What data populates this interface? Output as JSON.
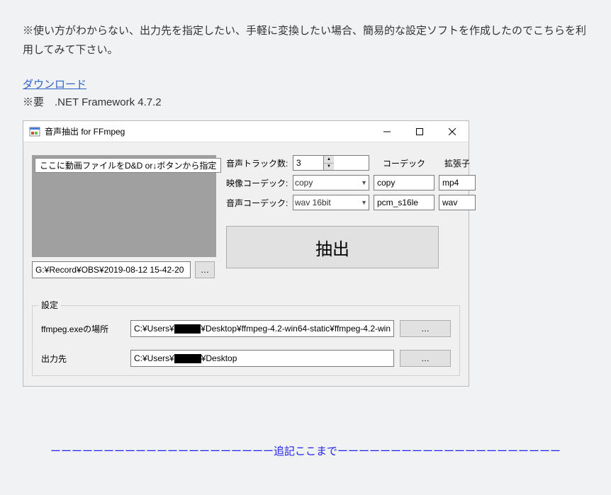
{
  "page": {
    "intro": "※使い方がわからない、出力先を指定したい、手軽に変換したい場合、簡易的な設定ソフトを作成したのでこちらを利用してみて下さい。",
    "download_link": "ダウンロード",
    "framework_note": "※要　.NET Framework 4.7.2",
    "divider": "ーーーーーーーーーーーーーーーーーーーーー追記ここまでーーーーーーーーーーーーーーーーーーーーー"
  },
  "window": {
    "title": "音声抽出 for FFmpeg",
    "dropzone_hint": "ここに動画ファイルをD&D or↓ボタンから指定",
    "source_file": "G:¥Record¥OBS¥2019-08-12 15-42-20",
    "browse_label": "…",
    "labels": {
      "track_count": "音声トラック数:",
      "video_codec": "映像コーデック:",
      "audio_codec": "音声コーデック:",
      "codec_header": "コーデック",
      "ext_header": "拡張子"
    },
    "values": {
      "track_count": "3",
      "video_codec_combo": "copy",
      "video_codec_text": "copy",
      "video_ext": "mp4",
      "audio_codec_combo": "wav 16bit",
      "audio_codec_text": "pcm_s16le",
      "audio_ext": "wav"
    },
    "extract_button": "抽出",
    "settings": {
      "legend": "設定",
      "ffmpeg_label": "ffmpeg.exeの場所",
      "ffmpeg_path_pre": "C:¥Users¥",
      "ffmpeg_path_post": "¥Desktop¥ffmpeg-4.2-win64-static¥ffmpeg-4.2-win",
      "output_label": "出力先",
      "output_path_pre": "C:¥Users¥",
      "output_path_post": "¥Desktop",
      "browse": "…"
    }
  }
}
